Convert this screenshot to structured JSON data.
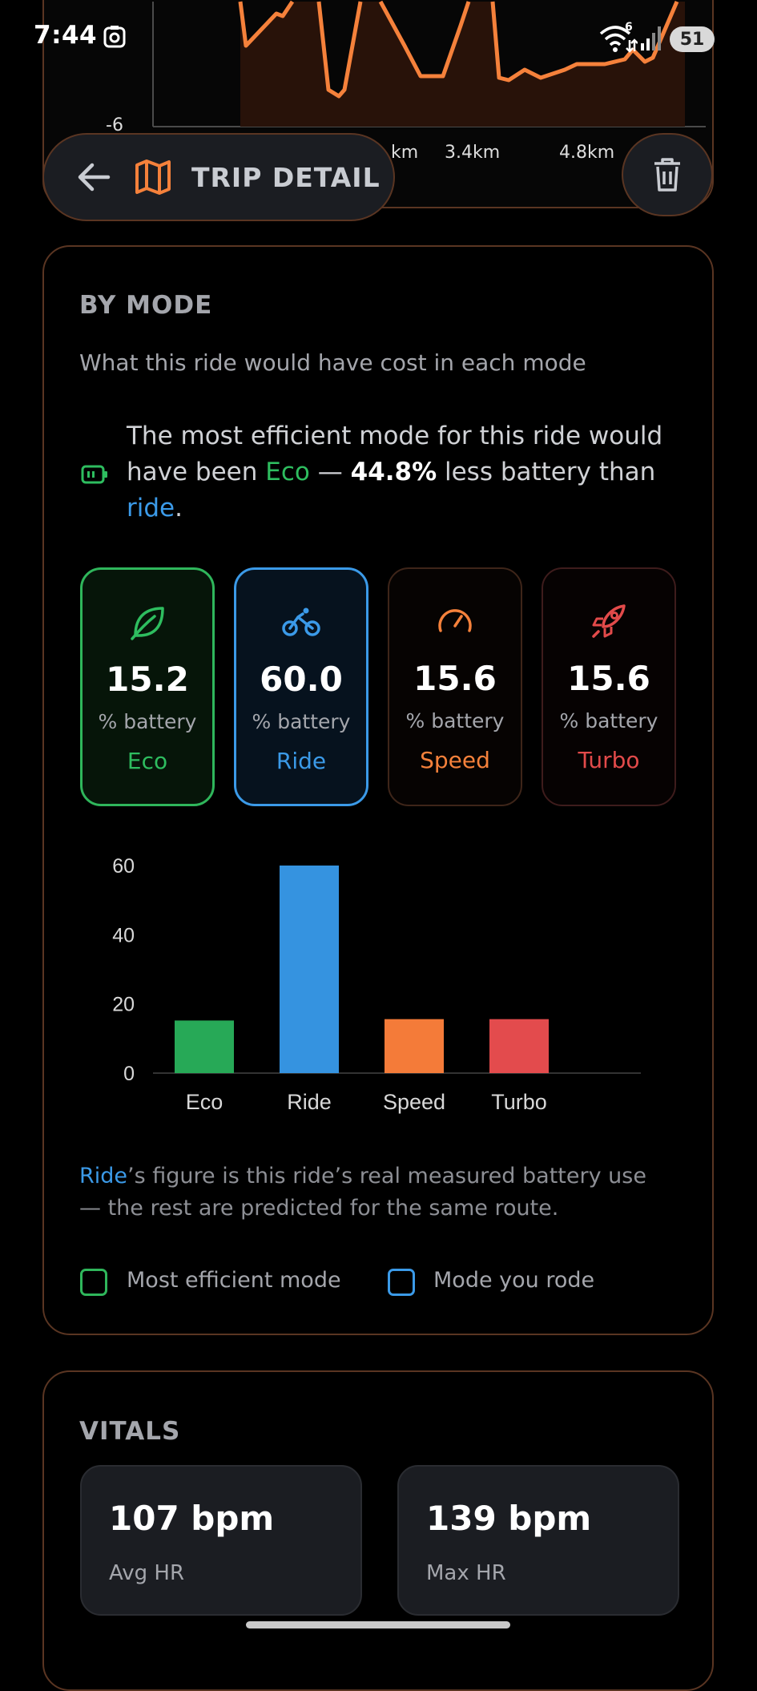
{
  "status_bar": {
    "time": "7:44",
    "battery": "51",
    "wifi_badge": "6"
  },
  "elevation_chart": {
    "tick_y": "-6",
    "tick_x": [
      "km",
      "3.4km",
      "4.8km"
    ]
  },
  "header": {
    "title": "TRIP DETAIL"
  },
  "by_mode": {
    "title": "BY MODE",
    "subtitle": "What this ride would have cost in each mode",
    "insight": {
      "part1": "The most efficient mode for this ride would have been ",
      "best_mode": "Eco",
      "dash": " — ",
      "percent": "44.8%",
      "part2": " less battery than ",
      "rode_mode": "ride",
      "end": "."
    },
    "modes": [
      {
        "name": "Eco",
        "value": "15.2",
        "unit": "% battery",
        "icon": "leaf-icon",
        "color": "#2ebd5f"
      },
      {
        "name": "Ride",
        "value": "60.0",
        "unit": "% battery",
        "icon": "bicycle-icon",
        "color": "#3b9ae8"
      },
      {
        "name": "Speed",
        "value": "15.6",
        "unit": "% battery",
        "icon": "speedometer-icon",
        "color": "#f5813b"
      },
      {
        "name": "Turbo",
        "value": "15.6",
        "unit": "% battery",
        "icon": "rocket-icon",
        "color": "#e24a4a"
      }
    ],
    "note": {
      "mode": "Ride",
      "rest": "’s figure is this ride’s real measured battery use — the rest are predicted for the same route."
    },
    "legend": {
      "efficient": "Most efficient mode",
      "rode": "Mode you rode"
    }
  },
  "chart_data": {
    "type": "bar",
    "categories": [
      "Eco",
      "Ride",
      "Speed",
      "Turbo"
    ],
    "values": [
      15.2,
      60.0,
      15.6,
      15.6
    ],
    "colors": [
      "#27a957",
      "#3593e0",
      "#f47b39",
      "#e34b4d"
    ],
    "yticks": [
      0,
      20,
      40,
      60
    ],
    "ylim": [
      0,
      60
    ],
    "grid": false,
    "title": "",
    "xlabel": "",
    "ylabel": ""
  },
  "vitals": {
    "title": "VITALS",
    "avg_value": "107 bpm",
    "avg_label": "Avg HR",
    "max_value": "139 bpm",
    "max_label": "Max HR"
  },
  "colors": {
    "accent": "#f5813b",
    "card_border": "#5a3522",
    "background": "#000000"
  }
}
